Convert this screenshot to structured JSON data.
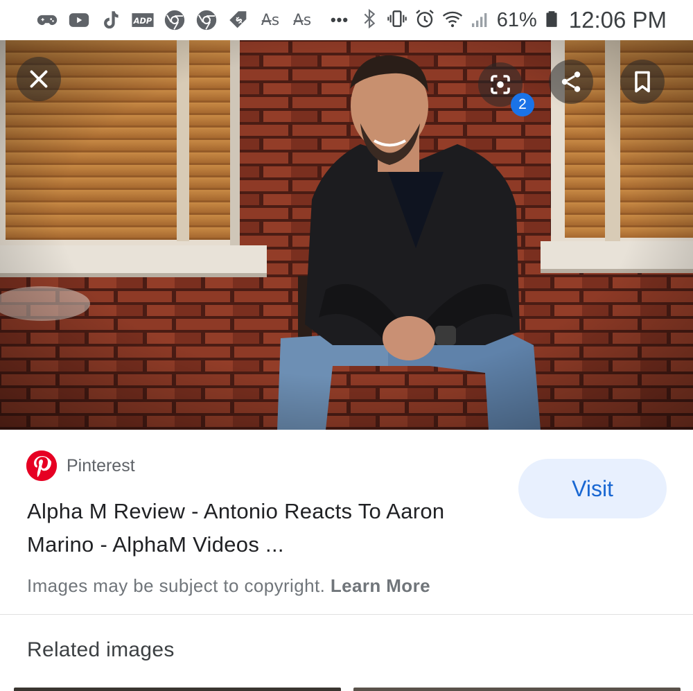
{
  "status_bar": {
    "icons_left": [
      "gamepad-icon",
      "youtube-icon",
      "tiktok-icon",
      "adp-icon",
      "chrome-icon",
      "chrome-icon",
      "price-tag-icon",
      "font-icon",
      "font-icon"
    ],
    "font_glyph": "A̶s",
    "overflow": "•••",
    "icons_right": [
      "bluetooth-icon",
      "vibrate-icon",
      "alarm-icon",
      "wifi-icon",
      "signal-icon",
      "battery-icon"
    ],
    "battery_percent": "61%",
    "time": "12:06 PM"
  },
  "image_viewer": {
    "lens_badge_count": "2",
    "buttons": [
      "close-icon",
      "lens-icon",
      "share-icon",
      "bookmark-icon"
    ]
  },
  "result": {
    "source": "Pinterest",
    "title": "Alpha M Review - Antonio Reacts To Aaron Marino - AlphaM Videos ...",
    "visit_label": "Visit",
    "copyright_text": "Images may be subject to copyright.",
    "learn_more": "Learn More"
  },
  "related": {
    "heading": "Related images"
  },
  "colors": {
    "accent": "#1a73e8",
    "visit_bg": "#e8f0fe",
    "pinterest": "#e60023"
  }
}
